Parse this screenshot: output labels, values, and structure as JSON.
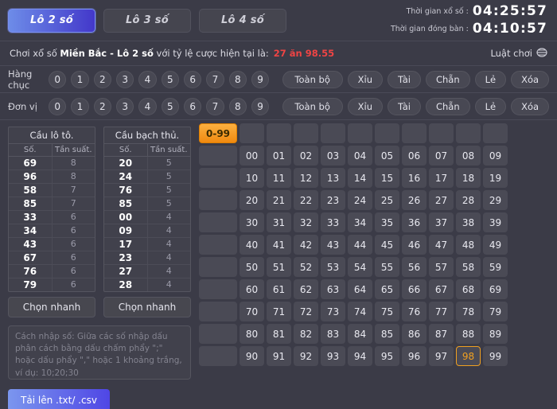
{
  "tabs": [
    {
      "label": "Lô 2 số",
      "active": true
    },
    {
      "label": "Lô 3 số",
      "active": false
    },
    {
      "label": "Lô 4 số",
      "active": false
    }
  ],
  "clocks": {
    "draw_label": "Thời gian xổ số :",
    "draw_value": "04:25:57",
    "close_label": "Thời gian đóng bàn :",
    "close_value": "04:10:57"
  },
  "subtitle": {
    "prefix": "Chơi xổ số ",
    "bold": "Miền Bắc - Lô 2 số",
    "middle": " với tỷ lệ cược hiện tại là:",
    "rate": "27 ăn 98.55",
    "rules_label": "Luật chơi",
    "rules_icon": "stamp-icon"
  },
  "selectors": {
    "tens_label": "Hàng chục",
    "units_label": "Đơn vị",
    "digits": [
      "0",
      "1",
      "2",
      "3",
      "4",
      "5",
      "6",
      "7",
      "8",
      "9"
    ],
    "actions": [
      "Toàn bộ",
      "Xỉu",
      "Tài",
      "Chẵn",
      "Lẻ",
      "Xóa"
    ]
  },
  "left_panel": {
    "table_a": {
      "title": "Cầu lô tô.",
      "col_number": "Số.",
      "col_freq": "Tần suất.",
      "rows": [
        {
          "number": "69",
          "freq": "8"
        },
        {
          "number": "96",
          "freq": "8"
        },
        {
          "number": "58",
          "freq": "7"
        },
        {
          "number": "85",
          "freq": "7"
        },
        {
          "number": "33",
          "freq": "6"
        },
        {
          "number": "34",
          "freq": "6"
        },
        {
          "number": "43",
          "freq": "6"
        },
        {
          "number": "67",
          "freq": "6"
        },
        {
          "number": "76",
          "freq": "6"
        },
        {
          "number": "79",
          "freq": "6"
        }
      ]
    },
    "table_b": {
      "title": "Cầu bạch thủ.",
      "col_number": "Số.",
      "col_freq": "Tần suất.",
      "rows": [
        {
          "number": "20",
          "freq": "5"
        },
        {
          "number": "24",
          "freq": "5"
        },
        {
          "number": "76",
          "freq": "5"
        },
        {
          "number": "85",
          "freq": "5"
        },
        {
          "number": "00",
          "freq": "4"
        },
        {
          "number": "09",
          "freq": "4"
        },
        {
          "number": "17",
          "freq": "4"
        },
        {
          "number": "23",
          "freq": "4"
        },
        {
          "number": "27",
          "freq": "4"
        },
        {
          "number": "28",
          "freq": "4"
        }
      ]
    },
    "quick_pick_a": "Chọn nhanh",
    "quick_pick_b": "Chọn nhanh",
    "hint": "Cách nhập số: Giữa các số nhập dấu phân cách bằng dấu chấm phẩy \";\" hoặc dấu phẩy \",\" hoặc 1 khoảng trắng, ví dụ: 10;20;30",
    "upload_label": "Tải lên .txt/ .csv"
  },
  "grid": {
    "range_button": "0-99",
    "column_headers": [
      "",
      "",
      "",
      "",
      "",
      "",
      "",
      "",
      "",
      ""
    ],
    "row_headers": [
      "",
      "",
      "",
      "",
      "",
      "",
      "",
      "",
      "",
      ""
    ],
    "numbers": [
      [
        "00",
        "01",
        "02",
        "03",
        "04",
        "05",
        "06",
        "07",
        "08",
        "09"
      ],
      [
        "10",
        "11",
        "12",
        "13",
        "14",
        "15",
        "16",
        "17",
        "18",
        "19"
      ],
      [
        "20",
        "21",
        "22",
        "23",
        "24",
        "25",
        "26",
        "27",
        "28",
        "29"
      ],
      [
        "30",
        "31",
        "32",
        "33",
        "34",
        "35",
        "36",
        "37",
        "38",
        "39"
      ],
      [
        "40",
        "41",
        "42",
        "43",
        "44",
        "45",
        "46",
        "47",
        "48",
        "49"
      ],
      [
        "50",
        "51",
        "52",
        "53",
        "54",
        "55",
        "56",
        "57",
        "58",
        "59"
      ],
      [
        "60",
        "61",
        "62",
        "63",
        "64",
        "65",
        "66",
        "67",
        "68",
        "69"
      ],
      [
        "70",
        "71",
        "72",
        "73",
        "74",
        "75",
        "76",
        "77",
        "78",
        "79"
      ],
      [
        "80",
        "81",
        "82",
        "83",
        "84",
        "85",
        "86",
        "87",
        "88",
        "89"
      ],
      [
        "90",
        "91",
        "92",
        "93",
        "94",
        "95",
        "96",
        "97",
        "98",
        "99"
      ]
    ],
    "selected": [
      "98"
    ]
  },
  "colors": {
    "background": "#3b3b47",
    "panel": "#41414c",
    "cell": "#4a4a55",
    "accent_blue": "#4f46e5",
    "accent_orange": "#f0a020",
    "rate_red": "#ef4444"
  }
}
